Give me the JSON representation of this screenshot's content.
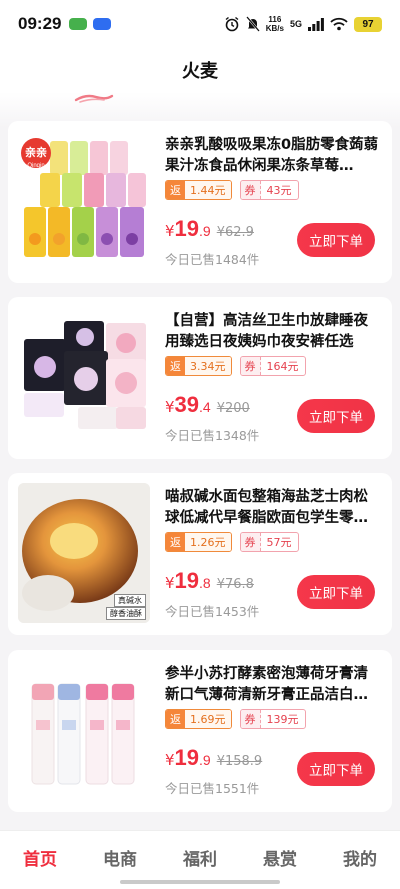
{
  "status": {
    "time": "09:29",
    "net_speed": "116",
    "net_unit": "KB/s",
    "signal": "5G",
    "battery": "97"
  },
  "header": {
    "title": "火麦"
  },
  "products": [
    {
      "title": "亲亲乳酸吸吸果冻0脂肪零食蒟蒻果汁冻食品休闲果冻条草莓…",
      "rebate_label": "返",
      "rebate_value": "1.44元",
      "coupon_label": "券",
      "coupon_value": "43元",
      "currency": "¥",
      "price_int": "19",
      "price_dec": ".9",
      "original_price": "¥62.9",
      "sold": "今日已售1484件",
      "buy_label": "立即下单",
      "brand_text": "亲亲",
      "brand_sub": "Qinqin"
    },
    {
      "title": "【自营】高洁丝卫生巾放肆睡夜用臻选日夜姨妈巾夜安裤任选",
      "rebate_label": "返",
      "rebate_value": "3.34元",
      "coupon_label": "券",
      "coupon_value": "164元",
      "currency": "¥",
      "price_int": "39",
      "price_dec": ".4",
      "original_price": "¥200",
      "sold": "今日已售1348件",
      "buy_label": "立即下单"
    },
    {
      "title": "喵叔碱水面包整箱海盐芝士肉松球低减代早餐脂欧面包学生零…",
      "rebate_label": "返",
      "rebate_value": "1.26元",
      "coupon_label": "券",
      "coupon_value": "57元",
      "currency": "¥",
      "price_int": "19",
      "price_dec": ".8",
      "original_price": "¥76.8",
      "sold": "今日已售1453件",
      "buy_label": "立即下单",
      "img_label1": "真碱水",
      "img_label2": "醇香油酥"
    },
    {
      "title": "参半小苏打酵素密泡薄荷牙膏清新口气薄荷清新牙膏正品洁白…",
      "rebate_label": "返",
      "rebate_value": "1.69元",
      "coupon_label": "券",
      "coupon_value": "139元",
      "currency": "¥",
      "price_int": "19",
      "price_dec": ".9",
      "original_price": "¥158.9",
      "sold": "今日已售1551件",
      "buy_label": "立即下单"
    }
  ],
  "tabs": [
    {
      "label": "首页",
      "active": true
    },
    {
      "label": "电商",
      "active": false
    },
    {
      "label": "福利",
      "active": false
    },
    {
      "label": "悬赏",
      "active": false
    },
    {
      "label": "我的",
      "active": false
    }
  ],
  "colors": {
    "accent": "#ef2e3e",
    "rebate": "#f5863a"
  }
}
